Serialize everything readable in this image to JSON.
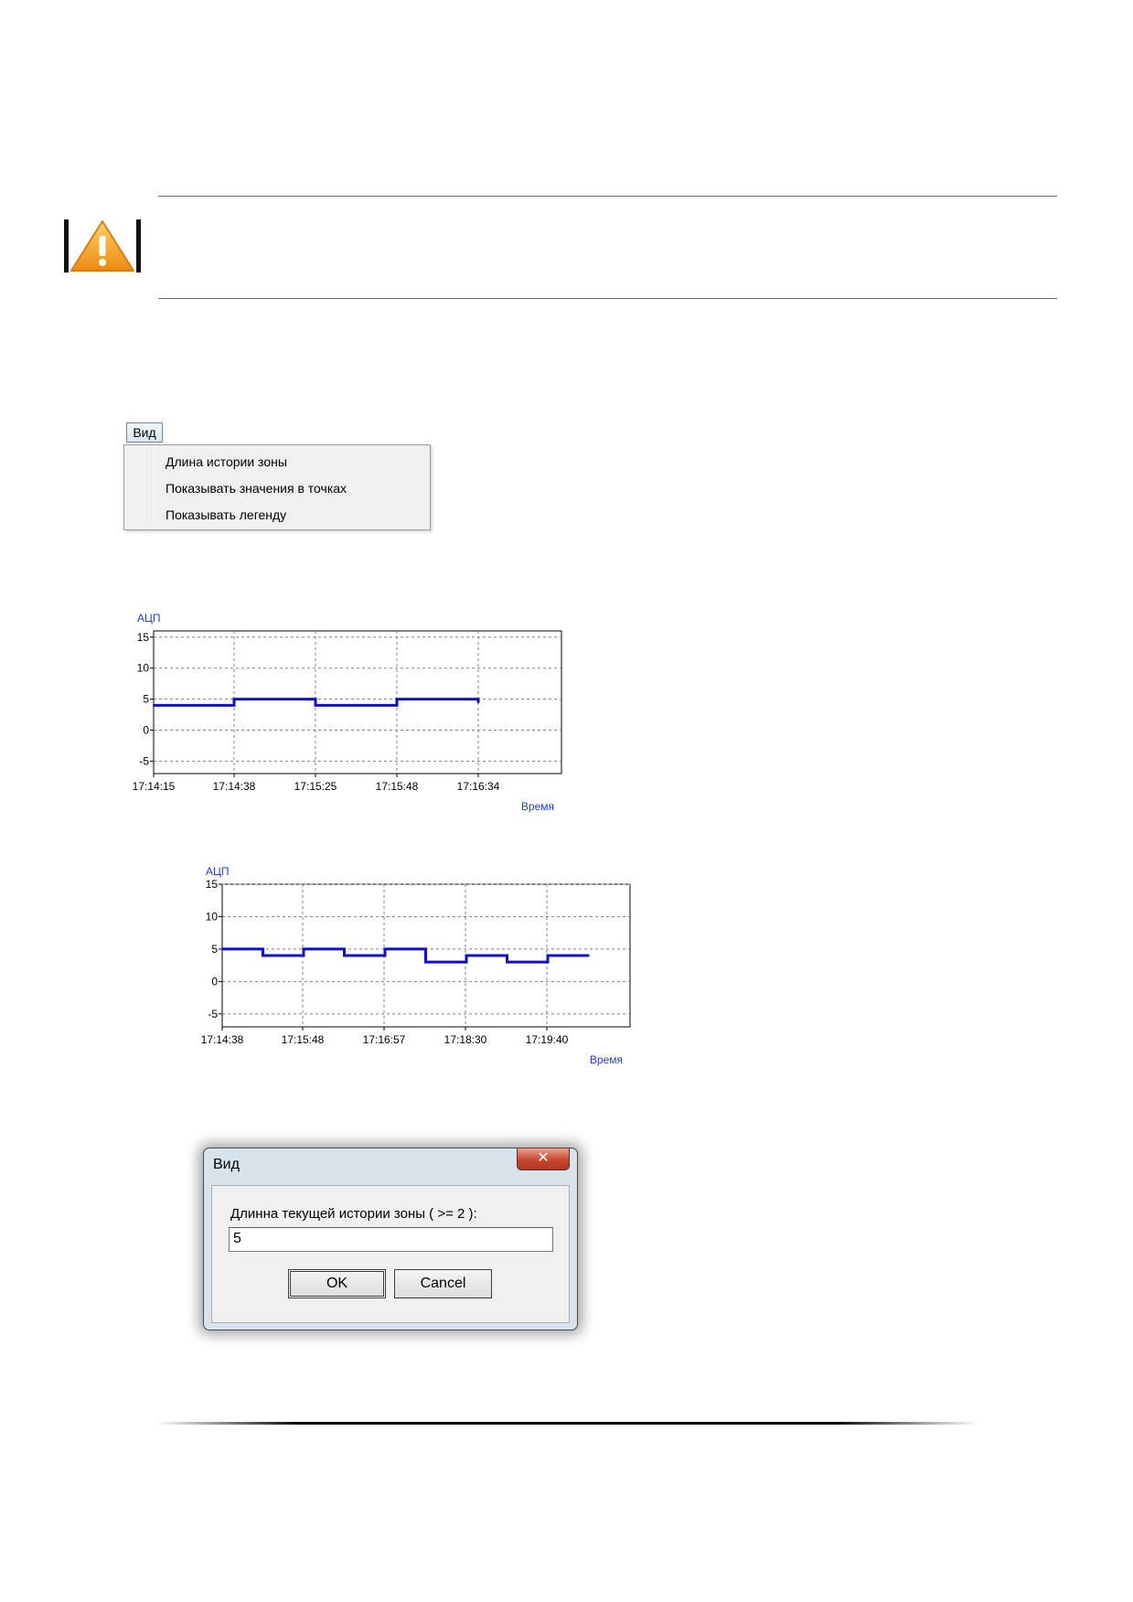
{
  "menu": {
    "button_label": "Вид",
    "items": [
      {
        "label": "Длина истории зоны"
      },
      {
        "label": "Показывать значения в точках"
      },
      {
        "label": "Показывать легенду"
      }
    ]
  },
  "chart_data": [
    {
      "type": "line",
      "ylabel": "АЦП",
      "xlabel": "Время",
      "ylim": [
        -7,
        16
      ],
      "yticks": [
        15,
        10,
        5,
        0,
        -5
      ],
      "xticks": [
        "17:14:15",
        "17:14:38",
        "17:15:25",
        "17:15:48",
        "17:16:34"
      ],
      "grid": true,
      "series": [
        {
          "x": [
            "17:14:15",
            "17:14:38",
            "17:14:38",
            "17:15:25",
            "17:15:25",
            "17:15:48",
            "17:15:48",
            "17:16:34"
          ],
          "values": [
            4,
            4,
            5,
            5,
            4,
            4,
            5,
            5
          ],
          "color": "#1010c8"
        }
      ]
    },
    {
      "type": "line",
      "ylabel": "АЦП",
      "xlabel": "Время",
      "ylim": [
        -7,
        15
      ],
      "yticks": [
        15,
        10,
        5,
        0,
        -5
      ],
      "xticks": [
        "17:14:38",
        "17:15:48",
        "17:16:57",
        "17:18:30",
        "17:19:40"
      ],
      "grid": true,
      "series": [
        {
          "values": [
            5,
            4,
            5,
            4,
            5,
            3,
            4,
            3,
            4
          ],
          "color": "#1010c8"
        }
      ]
    }
  ],
  "dialog": {
    "title": "Вид",
    "close_label": "✕",
    "prompt": "Длинна текущей истории зоны ( >= 2 ):",
    "input_value": "5",
    "ok_label": "OK",
    "cancel_label": "Cancel"
  },
  "colors": {
    "warning_fill": "#f7a21b",
    "series": "#1010c8",
    "axis_title": "#1f3fd0"
  }
}
